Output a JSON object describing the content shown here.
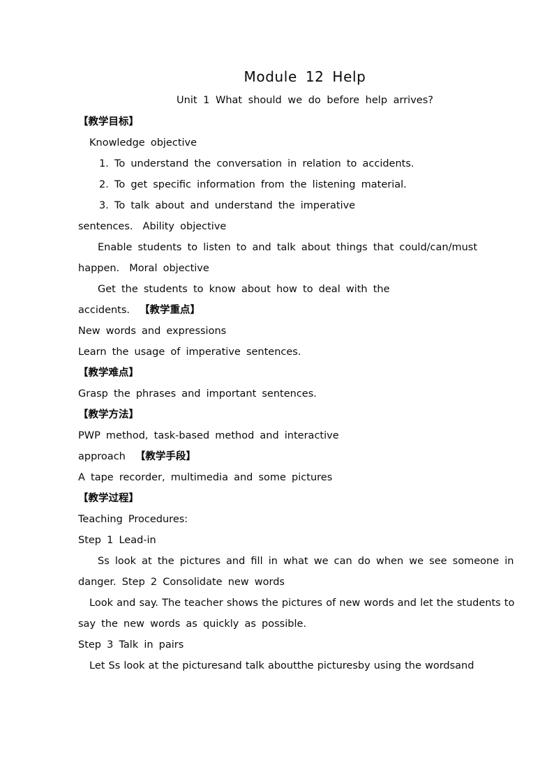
{
  "document": {
    "title": "Module 12  Help",
    "subtitle": "Unit 1 What should we do before help arrives?",
    "sections": {
      "objectives_heading": "【教学目标】",
      "knowledge_objective_label": "Knowledge objective",
      "objective_items": [
        "1.  To understand the conversation in relation to accidents.",
        "2.  To get specific information from the listening material.",
        "3. To talk about and understand the imperative"
      ],
      "sentences_ability": "sentences.",
      "ability_objective_label": "Ability objective",
      "ability_text": "Enable students to listen to and talk about things that could/can/must",
      "ability_text_cont": "happen.",
      "moral_objective_label": "Moral objective",
      "moral_text": "Get the students to know about how to deal with the",
      "moral_text_cont": "accidents.",
      "key_points_heading": "【教学重点】",
      "key_points_line1": "New words and expressions",
      "key_points_line2": "Learn the usage of imperative sentences.",
      "difficulties_heading": "【教学难点】",
      "difficulties_line": "Grasp the phrases and important sentences.",
      "methods_heading": "【教学方法】",
      "methods_line1": "PWP method, task-based method and interactive",
      "methods_line2_cont": "approach",
      "aids_heading": "【教学手段】",
      "aids_line": "A tape recorder, multimedia and some pictures",
      "process_heading": "【教学过程】",
      "procedures_label": "Teaching Procedures:",
      "step1_heading": "Step 1 Lead-in",
      "step1_text": "Ss look at the pictures and fill in what we can do when we see someone in",
      "step1_text_cont": "danger.",
      "step2_heading": "Step 2 Consolidate new words",
      "step2_text": "Look and say. The teacher shows the pictures of new words and let the students to",
      "step2_text_cont": "say the new words as quickly as possible.",
      "step3_heading": "Step 3 Talk in pairs",
      "step3_text": "Let Ss look at the picturesand talk aboutthe picturesby using the wordsand"
    }
  },
  "colors": {
    "page_background": "#ffffff",
    "text": "#0a0a0a"
  }
}
